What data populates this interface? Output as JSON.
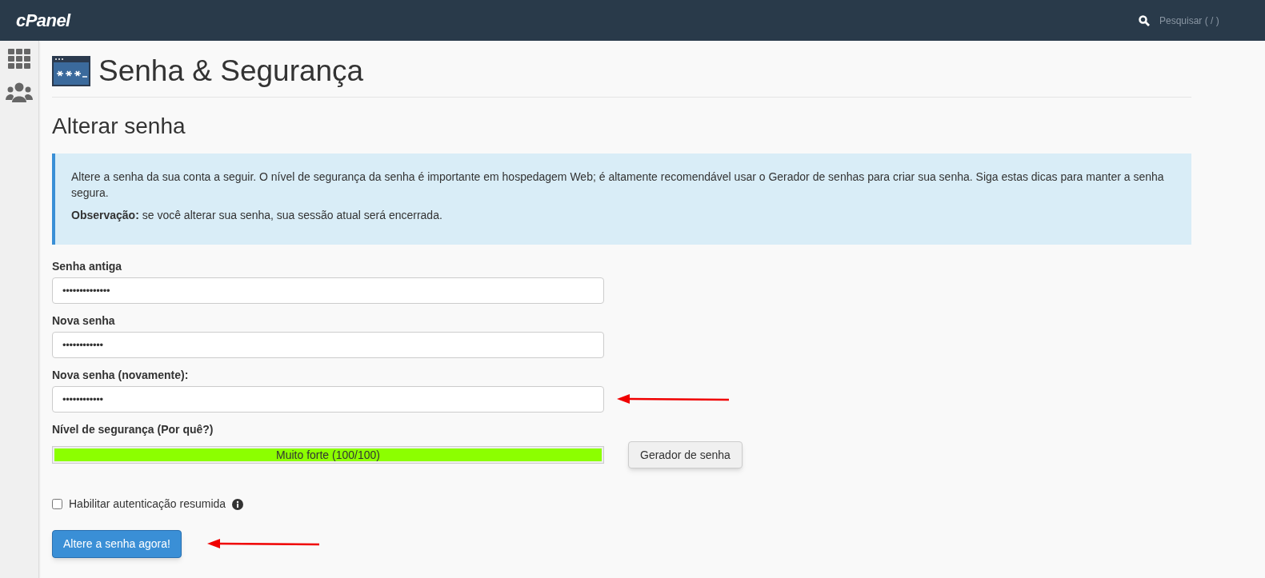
{
  "top_bar": {
    "logo": "cPanel",
    "search": {
      "placeholder": "Pesquisar ( / )"
    }
  },
  "page": {
    "title": "Senha & Segurança",
    "section_title": "Alterar senha"
  },
  "info": {
    "paragraphs": [
      "Altere a senha da sua conta a seguir. O nível de segurança da senha é importante em hospedagem Web; é altamente recomendável usar o Gerador de senhas para criar sua senha. Siga estas dicas para manter a senha segura.",
      "**Observação:** se você alterar sua senha, sua sessão atual será encerrada."
    ]
  },
  "fields": [
    {
      "label": "Senha antiga",
      "value": "••••••••••••••"
    },
    {
      "label": "Nova senha",
      "value": "••••••••••••"
    },
    {
      "label": "Nova senha (novamente):",
      "value": "••••••••••••",
      "annotated": true
    }
  ],
  "strength": {
    "label": "Nível de segurança (Por quê?)",
    "reading": "Muito forte (100/100)",
    "level": 1,
    "color": "#8cff00"
  },
  "generator_button": "Gerador de senha",
  "digest_auth": {
    "label": "Habilitar autenticação resumida",
    "checked": false
  },
  "submit": {
    "label": "Altere a senha agora!",
    "annotated": true
  }
}
